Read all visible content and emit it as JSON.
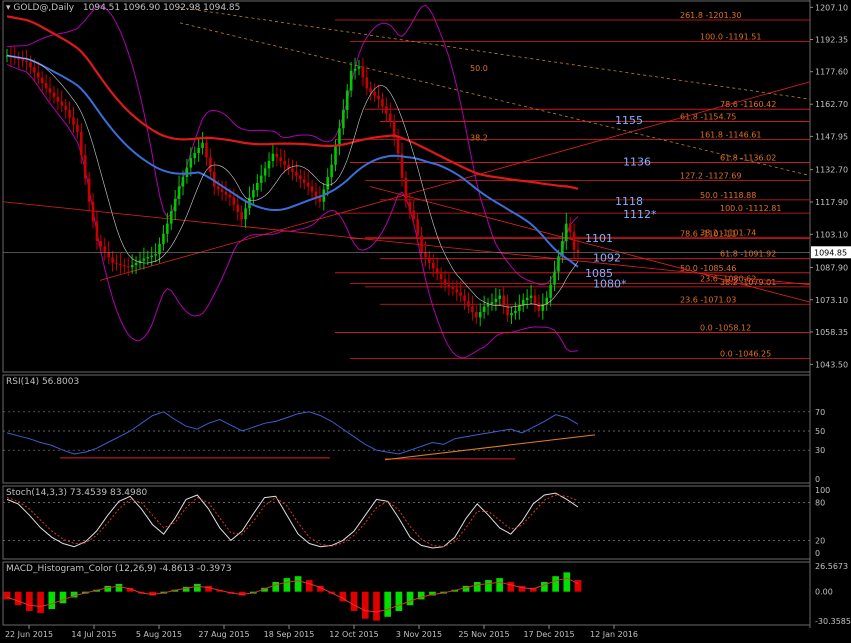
{
  "header": {
    "symbol": "GOLD@,Daily",
    "ohlc": "1094.51 1096.90 1092.98 1094.85"
  },
  "colors": {
    "background": "#000000",
    "grid": "#3a3a3a",
    "bull_candle": "#00c800",
    "bear_candle": "#c80000",
    "ma_red": "#e01818",
    "ma_blue": "#3a6ed8",
    "bands": "#b000b0",
    "fib_line": "#e02020",
    "fib_text": "#e07020",
    "level_text": "#7fb2ff",
    "rsi_line": "#3a5fcf",
    "stoch_main": "#e0e0e0",
    "stoch_signal": "#e03030",
    "macd_up": "#00e000",
    "macd_down": "#e00000",
    "text": "#c0c0c0"
  },
  "chart_data": [
    {
      "type": "candlestick",
      "title": "GOLD@,Daily",
      "ylim": [
        1040,
        1210
      ],
      "y_ticks": [
        "1207.10",
        "1192.35",
        "1177.60",
        "1162.70",
        "1147.95",
        "1132.70",
        "1117.90",
        "1103.10",
        "1087.90",
        "1073.10",
        "1058.35",
        "1043.50"
      ],
      "x_ticks": [
        "22 Jun 2015",
        "14 Jul 2015",
        "5 Aug 2015",
        "27 Aug 2015",
        "18 Sep 2015",
        "12 Oct 2015",
        "3 Nov 2015",
        "25 Nov 2015",
        "17 Dec 2015",
        "12 Jan 2016"
      ],
      "close_path": [
        [
          0,
          1185
        ],
        [
          5,
          1182
        ],
        [
          10,
          1170
        ],
        [
          15,
          1160
        ],
        [
          18,
          1150
        ],
        [
          21,
          1118
        ],
        [
          23,
          1100
        ],
        [
          27,
          1090
        ],
        [
          31,
          1088
        ],
        [
          35,
          1092
        ],
        [
          38,
          1094
        ],
        [
          41,
          1108
        ],
        [
          44,
          1125
        ],
        [
          47,
          1138
        ],
        [
          50,
          1145
        ],
        [
          53,
          1125
        ],
        [
          57,
          1120
        ],
        [
          60,
          1110
        ],
        [
          62,
          1120
        ],
        [
          65,
          1130
        ],
        [
          68,
          1140
        ],
        [
          71,
          1135
        ],
        [
          74,
          1130
        ],
        [
          77,
          1125
        ],
        [
          80,
          1118
        ],
        [
          83,
          1135
        ],
        [
          86,
          1160
        ],
        [
          88,
          1178
        ],
        [
          90,
          1180
        ],
        [
          92,
          1170
        ],
        [
          95,
          1165
        ],
        [
          98,
          1155
        ],
        [
          100,
          1140
        ],
        [
          102,
          1118
        ],
        [
          104,
          1110
        ],
        [
          106,
          1095
        ],
        [
          108,
          1090
        ],
        [
          110,
          1085
        ],
        [
          112,
          1080
        ],
        [
          114,
          1078
        ],
        [
          116,
          1075
        ],
        [
          118,
          1070
        ],
        [
          120,
          1065
        ],
        [
          122,
          1070
        ],
        [
          124,
          1072
        ],
        [
          126,
          1075
        ],
        [
          128,
          1066
        ],
        [
          130,
          1068
        ],
        [
          132,
          1073
        ],
        [
          134,
          1075
        ],
        [
          136,
          1068
        ],
        [
          138,
          1074
        ],
        [
          140,
          1086
        ],
        [
          142,
          1100
        ],
        [
          143,
          1108
        ],
        [
          144,
          1104
        ],
        [
          145,
          1096
        ],
        [
          146,
          1094.85
        ]
      ],
      "current_price": "1094.85",
      "fibonacci_levels": [
        {
          "label": "261.8 -1201.30",
          "value": 1201.3
        },
        {
          "label": "100.0 -1191.51",
          "value": 1191.51
        },
        {
          "label": "78.6 -1160.42",
          "value": 1160.42
        },
        {
          "label": "61.8 -1154.75",
          "value": 1154.75
        },
        {
          "label": "161.8 -1146.61",
          "value": 1146.61
        },
        {
          "label": "61.8 -1136.02",
          "value": 1136.02
        },
        {
          "label": "127.2 -1127.69",
          "value": 1127.69
        },
        {
          "label": "50.0 -1118.88",
          "value": 1118.88
        },
        {
          "label": "100.0 -1112.81",
          "value": 1112.81
        },
        {
          "label": "78.6 -1101.11",
          "value": 1101.11
        },
        {
          "label": "38.2 -1101.74",
          "value": 1101.74
        },
        {
          "label": "61.8 -1091.92",
          "value": 1091.92
        },
        {
          "label": "50.0 -1085.46",
          "value": 1085.46
        },
        {
          "label": "23.6 -1080.62",
          "value": 1080.62
        },
        {
          "label": "38.2 -1079.01",
          "value": 1079.01
        },
        {
          "label": "23.6 -1071.03",
          "value": 1071.03
        },
        {
          "label": "0.0 -1058.12",
          "value": 1058.12
        },
        {
          "label": "0.0 -1046.25",
          "value": 1046.25
        }
      ],
      "fan_labels": [
        "50.0",
        "38.2"
      ],
      "level_labels": [
        {
          "text": "1155",
          "value": 1155
        },
        {
          "text": "1136",
          "value": 1136
        },
        {
          "text": "1118",
          "value": 1118
        },
        {
          "text": "1112*",
          "value": 1112
        },
        {
          "text": "1101",
          "value": 1101
        },
        {
          "text": "1092",
          "value": 1092
        },
        {
          "text": "1085",
          "value": 1085
        },
        {
          "text": "1080*",
          "value": 1080
        }
      ]
    },
    {
      "type": "line",
      "title": "RSI(14) 56.8003",
      "ylim": [
        0,
        100
      ],
      "y_ticks": [
        "70",
        "50",
        "30",
        "0"
      ],
      "levels": [
        70,
        50,
        30
      ],
      "values": [
        48,
        45,
        42,
        38,
        35,
        30,
        26,
        28,
        32,
        38,
        44,
        50,
        58,
        66,
        70,
        62,
        55,
        52,
        58,
        62,
        56,
        50,
        54,
        58,
        60,
        64,
        68,
        70,
        66,
        60,
        52,
        44,
        36,
        30,
        28,
        26,
        30,
        34,
        38,
        36,
        42,
        44,
        46,
        48,
        50,
        52,
        48,
        54,
        60,
        67,
        64,
        57
      ]
    },
    {
      "type": "line",
      "title": "Stoch(14,3,3) 73.4539 83.4980",
      "ylim": [
        0,
        100
      ],
      "y_ticks": [
        "100",
        "80",
        "20",
        "0"
      ],
      "levels": [
        80,
        20
      ],
      "main": [
        85,
        78,
        60,
        40,
        25,
        15,
        10,
        18,
        35,
        60,
        82,
        90,
        70,
        45,
        30,
        55,
        85,
        92,
        70,
        40,
        20,
        35,
        62,
        88,
        90,
        60,
        30,
        15,
        10,
        12,
        20,
        35,
        60,
        85,
        82,
        55,
        25,
        12,
        8,
        10,
        25,
        55,
        78,
        60,
        40,
        30,
        50,
        78,
        92,
        95,
        85,
        73
      ],
      "signal": [
        88,
        82,
        70,
        52,
        35,
        22,
        15,
        16,
        28,
        48,
        70,
        85,
        80,
        60,
        40,
        48,
        72,
        88,
        80,
        56,
        32,
        30,
        50,
        75,
        88,
        75,
        48,
        25,
        14,
        11,
        16,
        28,
        48,
        72,
        82,
        68,
        42,
        22,
        12,
        10,
        18,
        40,
        66,
        66,
        52,
        38,
        44,
        64,
        84,
        92,
        90,
        83
      ]
    },
    {
      "type": "bar",
      "title": "MACD_Histogram_Color (12,26,9) -4.8613 -0.3973",
      "ylim": [
        -30.3585,
        26.5673
      ],
      "y_ticks": [
        "26.5673",
        "0.00",
        "-30.3585"
      ],
      "values": [
        -8,
        -14,
        -20,
        -22,
        -18,
        -12,
        -6,
        -2,
        2,
        6,
        8,
        4,
        -2,
        -4,
        -2,
        2,
        5,
        8,
        6,
        2,
        -2,
        -4,
        -2,
        4,
        10,
        14,
        16,
        12,
        6,
        -2,
        -10,
        -20,
        -28,
        -30,
        -26,
        -20,
        -14,
        -8,
        -4,
        -2,
        2,
        6,
        10,
        12,
        14,
        10,
        6,
        4,
        10,
        16,
        20,
        12
      ]
    }
  ]
}
